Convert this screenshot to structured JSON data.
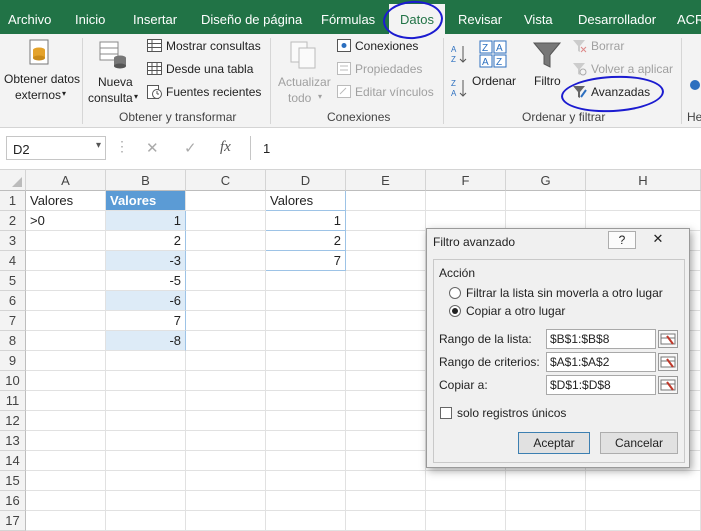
{
  "ribbon_tabs": [
    "Archivo",
    "Inicio",
    "Insertar",
    "Diseño de página",
    "Fórmulas",
    "Datos",
    "Revisar",
    "Vista",
    "Desarrollador",
    "ACR"
  ],
  "active_tab": "Datos",
  "groups": {
    "obtener": {
      "label": "Obtener y transformar",
      "get_external_line1": "Obtener datos",
      "get_external_line2": "externos",
      "new_query_line1": "Nueva",
      "new_query_line2": "consulta",
      "show_queries": "Mostrar consultas",
      "from_table": "Desde una tabla",
      "recent_sources": "Fuentes recientes"
    },
    "conexiones": {
      "label": "Conexiones",
      "refresh_line1": "Actualizar",
      "refresh_line2": "todo",
      "connections": "Conexiones",
      "properties": "Propiedades",
      "edit_links": "Editar vínculos"
    },
    "ordenar": {
      "label": "Ordenar y filtrar",
      "sort": "Ordenar",
      "filter": "Filtro",
      "clear": "Borrar",
      "reapply": "Volver a aplicar",
      "advanced": "Avanzadas"
    },
    "next_group_label": "He"
  },
  "formula_bar": {
    "name_box": "D2",
    "fx": "fx",
    "content": "1"
  },
  "columns": [
    "A",
    "B",
    "C",
    "D",
    "E",
    "F",
    "G",
    "H"
  ],
  "rows": [
    "1",
    "2",
    "3",
    "4",
    "5",
    "6",
    "7",
    "8",
    "9",
    "10",
    "11",
    "12",
    "13",
    "14",
    "15",
    "16",
    "17"
  ],
  "cells": {
    "A1": "Valores",
    "A2": ">0",
    "B1": "Valores",
    "B2": "1",
    "B3": "2",
    "B4": "-3",
    "B5": "-5",
    "B6": "-6",
    "B7": "7",
    "B8": "-8",
    "D1": "Valores",
    "D2": "1",
    "D3": "2",
    "D4": "7"
  },
  "dialog": {
    "title": "Filtro avanzado",
    "help": "?",
    "close": "✕",
    "action_label": "Acción",
    "option_filter": "Filtrar la lista sin moverla a otro lugar",
    "option_copy": "Copiar a otro lugar",
    "selected_option": "copy",
    "list_range_label": "Rango de la lista:",
    "list_range_value": "$B$1:$B$8",
    "criteria_range_label": "Rango de criterios:",
    "criteria_range_value": "$A$1:$A$2",
    "copy_to_label": "Copiar a:",
    "copy_to_value": "$D$1:$D$8",
    "unique_only_label": "solo registros únicos",
    "unique_only_checked": false,
    "ok": "Aceptar",
    "cancel": "Cancelar"
  },
  "colors": {
    "excel_green": "#217346",
    "table_header": "#5b9bd5",
    "table_band": "#ddebf7",
    "annotation": "#1b1bd0"
  }
}
